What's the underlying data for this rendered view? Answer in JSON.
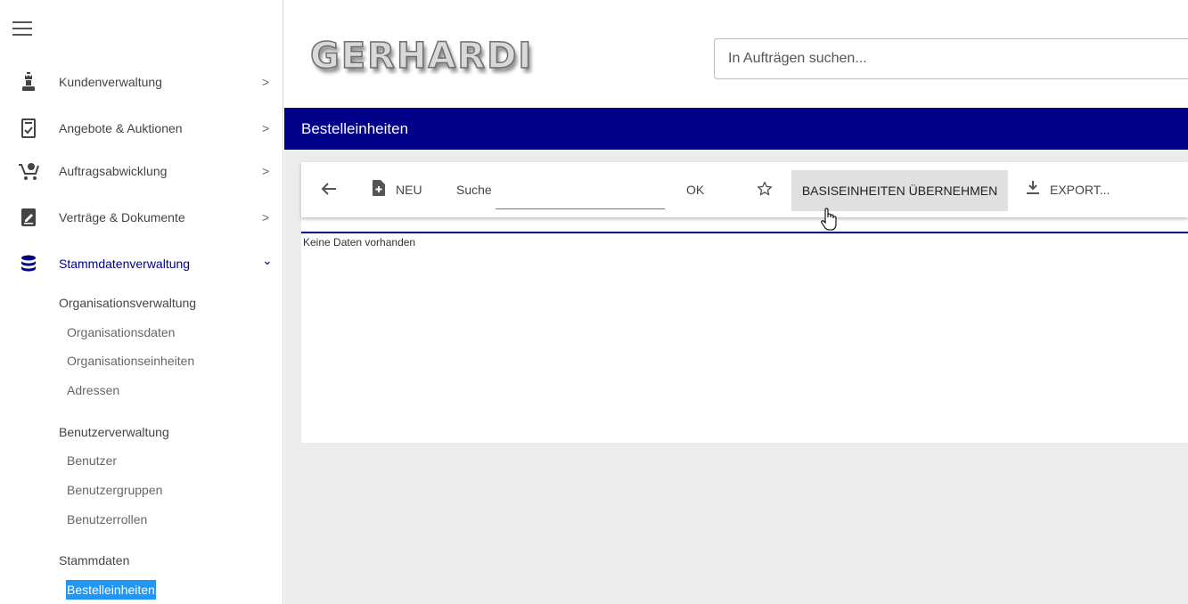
{
  "sidebar": {
    "menu_icon": "hamburger-menu-icon",
    "items": [
      {
        "label": "Kundenverwaltung",
        "icon": "chess-king-icon",
        "chevron": ">"
      },
      {
        "label": "Angebote & Auktionen",
        "icon": "receipt-icon",
        "chevron": ">"
      },
      {
        "label": "Auftragsabwicklung",
        "icon": "shopping-cart-icon",
        "chevron": ">"
      },
      {
        "label": "Verträge & Dokumente",
        "icon": "document-pen-icon",
        "chevron": ">"
      },
      {
        "label": "Stammdatenverwaltung",
        "icon": "database-icon",
        "chevron": "⌄"
      }
    ],
    "sections": [
      {
        "title": "Organisationsverwaltung",
        "links": [
          "Organisationsdaten",
          "Organisationseinheiten",
          "Adressen"
        ]
      },
      {
        "title": "Benutzerverwaltung",
        "links": [
          "Benutzer",
          "Benutzergruppen",
          "Benutzerrollen"
        ]
      },
      {
        "title": "Stammdaten",
        "links": [
          "Bestelleinheiten"
        ]
      }
    ]
  },
  "header": {
    "logo_text": "GERHARDI",
    "search_placeholder": "In Aufträgen suchen..."
  },
  "page": {
    "title": "Bestelleinheiten",
    "toolbar": {
      "new_label": "NEU",
      "search_label": "Suche",
      "search_value": "",
      "ok_label": "OK",
      "apply_label": "BASISEINHEITEN ÜBERNEHMEN",
      "export_label": "EXPORT..."
    },
    "empty_text": "Keine Daten vorhanden"
  },
  "colors": {
    "primary": "#000088",
    "selected": "#2196f3",
    "background": "#ececec"
  }
}
